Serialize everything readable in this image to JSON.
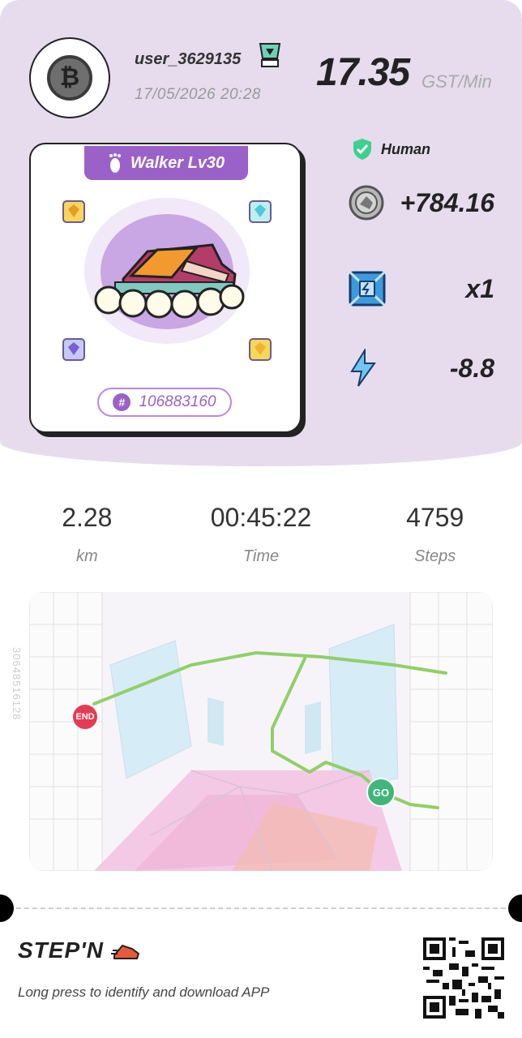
{
  "header": {
    "username": "user_3629135",
    "datetime": "17/05/2026 20:28",
    "rate_value": "17.35",
    "rate_unit": "GST/Min"
  },
  "sneaker": {
    "level_label": "Walker Lv30",
    "id": "106883160",
    "accent_color": "#9a61c9"
  },
  "side_stats": {
    "human_label": "Human",
    "earned": "+784.16",
    "multiplier": "x1",
    "energy": "-8.8"
  },
  "run": {
    "distance_value": "2.28",
    "distance_label": "km",
    "time_value": "00:45:22",
    "time_label": "Time",
    "steps_value": "4759",
    "steps_label": "Steps"
  },
  "map": {
    "end_label": "END",
    "go_label": "GO",
    "side_code": "30648516128",
    "route_color": "#8fd068"
  },
  "footer": {
    "brand": "STEP'N",
    "hint": "Long press to identify and download APP"
  }
}
